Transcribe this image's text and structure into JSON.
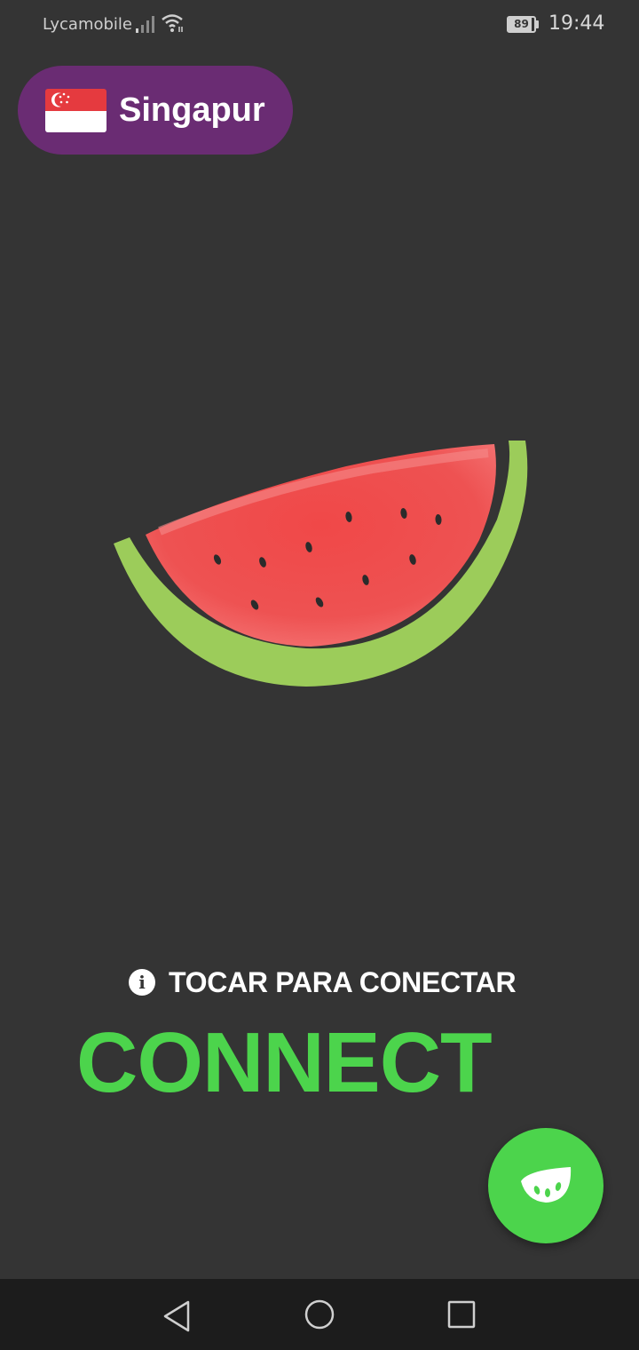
{
  "status_bar": {
    "carrier": "Lycamobile",
    "battery_level": 89,
    "battery_text": "89",
    "time": "19:44",
    "icons": [
      "signal-icon",
      "wifi-icon",
      "battery-icon"
    ]
  },
  "server": {
    "name": "Singapur",
    "flag_icon": "singapore-flag-icon"
  },
  "logo": {
    "icon": "watermelon-logo"
  },
  "hint": {
    "icon": "info-icon",
    "text": "TOCAR PARA CONECTAR"
  },
  "connect": {
    "label": "CONNECT"
  },
  "fab": {
    "icon": "watermelon-slice-icon"
  },
  "nav": {
    "icons": [
      "back-icon",
      "home-icon",
      "recents-icon"
    ]
  },
  "colors": {
    "background": "#343434",
    "pill": "#6a2c73",
    "accent_green": "#4cd44c",
    "melon_red": "#ef4b4b",
    "rind_green": "#9ccc5a"
  }
}
